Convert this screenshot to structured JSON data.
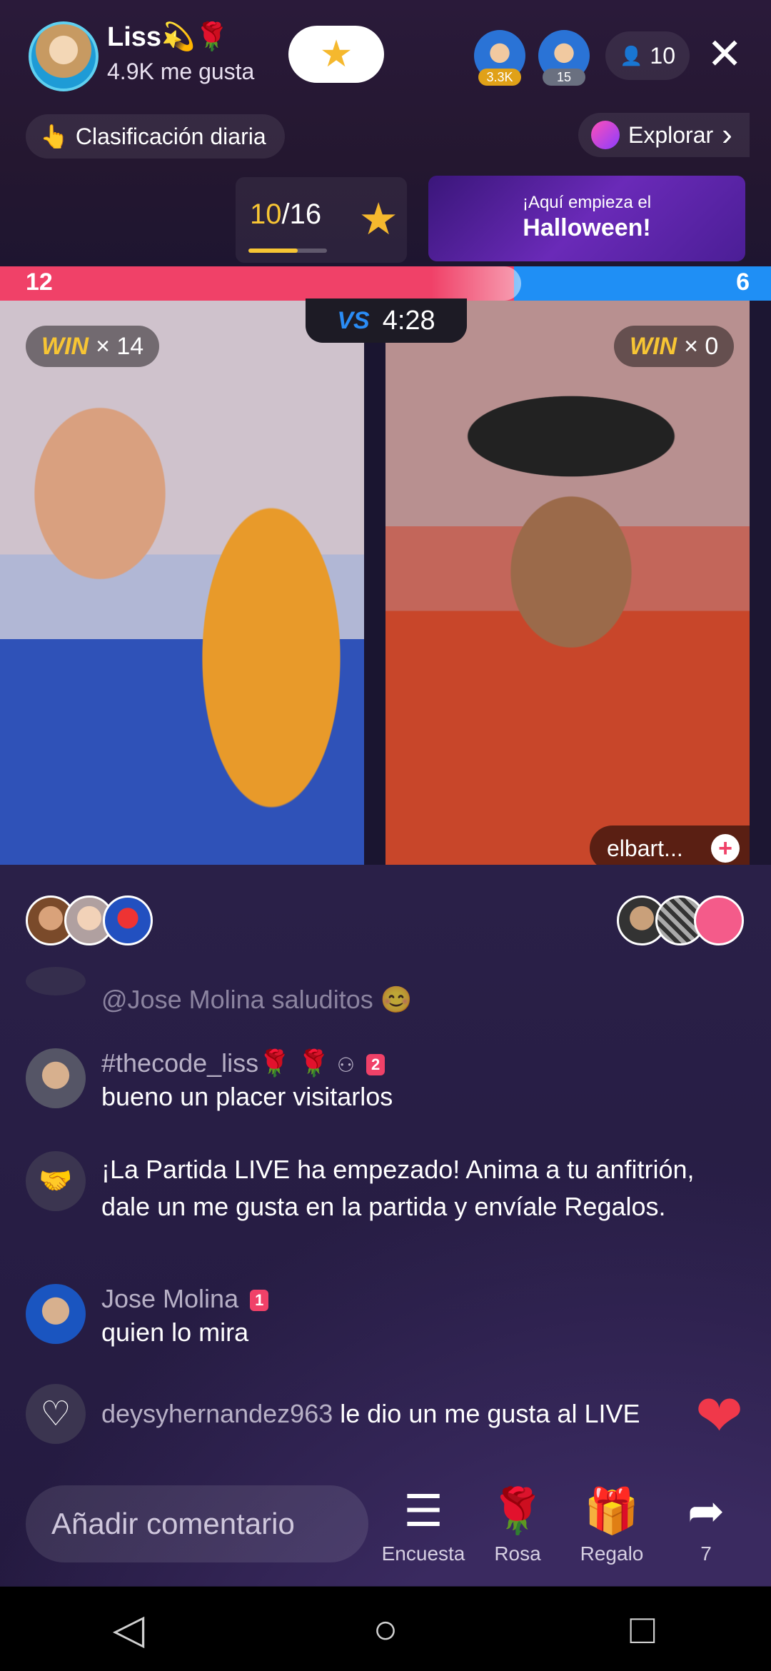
{
  "header": {
    "host_name": "Liss💫🌹",
    "host_likes": "4.9K me gusta",
    "follow_star": "★",
    "top_viewers": [
      {
        "badge": "3.3K",
        "badge_color": "#e0a118"
      },
      {
        "badge": "15",
        "badge_color": "#6a7080"
      }
    ],
    "viewer_icon": "👤",
    "viewer_count": "10",
    "close": "✕"
  },
  "rank": {
    "icon": "👆",
    "label": "Clasificación diaria"
  },
  "explore": {
    "label": "Explorar",
    "chevron": "›"
  },
  "goal": {
    "current": "10",
    "total": "/16",
    "star": "★",
    "progress_fraction": 0.625
  },
  "banner": {
    "line1": "¡Aquí empieza el",
    "line2": "Halloween!"
  },
  "battle": {
    "score_left": "12",
    "score_right": "6",
    "vs": "VS",
    "timer": "4:28",
    "win_word": "WIN",
    "left_wins": "× 14",
    "right_wins": "× 0",
    "opponent_name": "elbart...",
    "opponent_plus": "+"
  },
  "chat": [
    {
      "type": "text",
      "avatar": "",
      "name": "",
      "badges": "",
      "message": "@Jose Molina saluditos 😊",
      "faded": true
    },
    {
      "type": "text",
      "avatar": "👤",
      "name": "#thecode_liss🌹 🌹",
      "badge": "2",
      "message": "bueno un placer visitarlos"
    },
    {
      "type": "system",
      "avatar": "🤝",
      "message": "¡La Partida LIVE ha empezado! Anima a tu anfitrión, dale un me gusta en la partida y envíale Regalos."
    },
    {
      "type": "text",
      "avatar": "👤",
      "name": "Jose Molina",
      "badge": "1",
      "message": "quien lo mira"
    },
    {
      "type": "like",
      "avatar": "♡",
      "name": "deysyhernandez963",
      "message": "le dio un me gusta al LIVE"
    }
  ],
  "bottom": {
    "comment_placeholder": "Añadir comentario",
    "actions": [
      {
        "icon": "☰",
        "label": "Encuesta"
      },
      {
        "icon": "🌹",
        "label": "Rosa"
      },
      {
        "icon": "🎁",
        "label": "Regalo"
      },
      {
        "icon": "➦",
        "label": "7"
      }
    ]
  },
  "nav": {
    "back": "◁",
    "home": "○",
    "recents": "□"
  },
  "colors": {
    "red_team": "#f04168",
    "blue_team": "#1f8ff5",
    "gold": "#f7c534"
  }
}
